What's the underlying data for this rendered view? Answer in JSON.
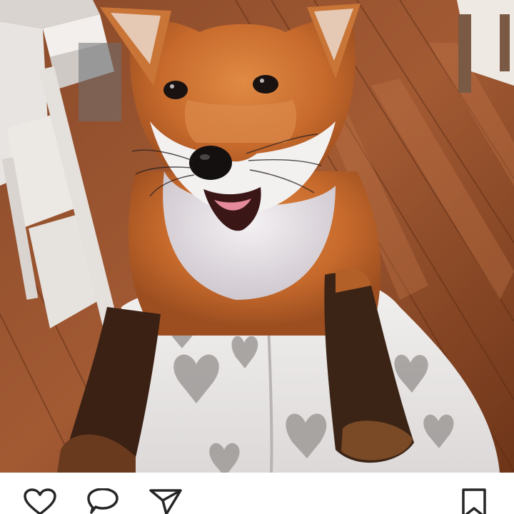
{
  "post": {
    "image": {
      "alt": ""
    },
    "actions": {
      "like": {
        "icon": "heart-outline-icon"
      },
      "comment": {
        "icon": "speech-bubble-icon"
      },
      "share": {
        "icon": "paper-plane-icon"
      },
      "save": {
        "icon": "bookmark-outline-icon"
      }
    }
  },
  "colors": {
    "background": "#ffffff",
    "icon_stroke": "#262626"
  }
}
